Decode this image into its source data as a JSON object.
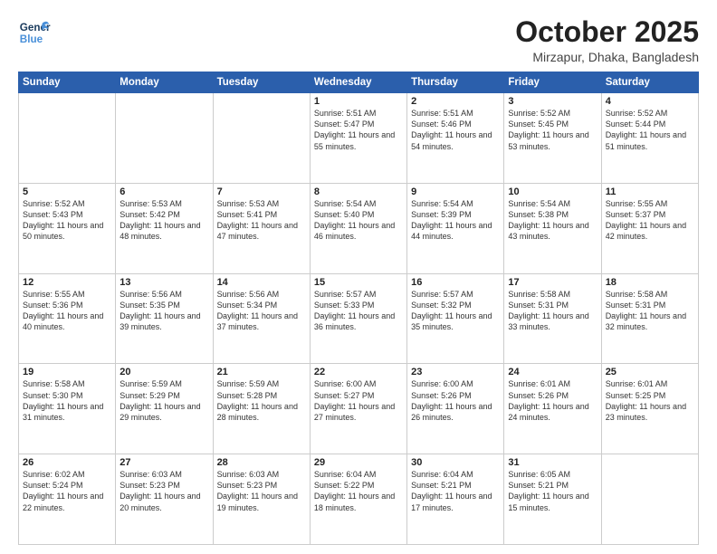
{
  "header": {
    "logo_general": "General",
    "logo_blue": "Blue",
    "title": "October 2025",
    "subtitle": "Mirzapur, Dhaka, Bangladesh"
  },
  "days_of_week": [
    "Sunday",
    "Monday",
    "Tuesday",
    "Wednesday",
    "Thursday",
    "Friday",
    "Saturday"
  ],
  "weeks": [
    [
      {
        "day": "",
        "info": ""
      },
      {
        "day": "",
        "info": ""
      },
      {
        "day": "",
        "info": ""
      },
      {
        "day": "1",
        "info": "Sunrise: 5:51 AM\nSunset: 5:47 PM\nDaylight: 11 hours\nand 55 minutes."
      },
      {
        "day": "2",
        "info": "Sunrise: 5:51 AM\nSunset: 5:46 PM\nDaylight: 11 hours\nand 54 minutes."
      },
      {
        "day": "3",
        "info": "Sunrise: 5:52 AM\nSunset: 5:45 PM\nDaylight: 11 hours\nand 53 minutes."
      },
      {
        "day": "4",
        "info": "Sunrise: 5:52 AM\nSunset: 5:44 PM\nDaylight: 11 hours\nand 51 minutes."
      }
    ],
    [
      {
        "day": "5",
        "info": "Sunrise: 5:52 AM\nSunset: 5:43 PM\nDaylight: 11 hours\nand 50 minutes."
      },
      {
        "day": "6",
        "info": "Sunrise: 5:53 AM\nSunset: 5:42 PM\nDaylight: 11 hours\nand 48 minutes."
      },
      {
        "day": "7",
        "info": "Sunrise: 5:53 AM\nSunset: 5:41 PM\nDaylight: 11 hours\nand 47 minutes."
      },
      {
        "day": "8",
        "info": "Sunrise: 5:54 AM\nSunset: 5:40 PM\nDaylight: 11 hours\nand 46 minutes."
      },
      {
        "day": "9",
        "info": "Sunrise: 5:54 AM\nSunset: 5:39 PM\nDaylight: 11 hours\nand 44 minutes."
      },
      {
        "day": "10",
        "info": "Sunrise: 5:54 AM\nSunset: 5:38 PM\nDaylight: 11 hours\nand 43 minutes."
      },
      {
        "day": "11",
        "info": "Sunrise: 5:55 AM\nSunset: 5:37 PM\nDaylight: 11 hours\nand 42 minutes."
      }
    ],
    [
      {
        "day": "12",
        "info": "Sunrise: 5:55 AM\nSunset: 5:36 PM\nDaylight: 11 hours\nand 40 minutes."
      },
      {
        "day": "13",
        "info": "Sunrise: 5:56 AM\nSunset: 5:35 PM\nDaylight: 11 hours\nand 39 minutes."
      },
      {
        "day": "14",
        "info": "Sunrise: 5:56 AM\nSunset: 5:34 PM\nDaylight: 11 hours\nand 37 minutes."
      },
      {
        "day": "15",
        "info": "Sunrise: 5:57 AM\nSunset: 5:33 PM\nDaylight: 11 hours\nand 36 minutes."
      },
      {
        "day": "16",
        "info": "Sunrise: 5:57 AM\nSunset: 5:32 PM\nDaylight: 11 hours\nand 35 minutes."
      },
      {
        "day": "17",
        "info": "Sunrise: 5:58 AM\nSunset: 5:31 PM\nDaylight: 11 hours\nand 33 minutes."
      },
      {
        "day": "18",
        "info": "Sunrise: 5:58 AM\nSunset: 5:31 PM\nDaylight: 11 hours\nand 32 minutes."
      }
    ],
    [
      {
        "day": "19",
        "info": "Sunrise: 5:58 AM\nSunset: 5:30 PM\nDaylight: 11 hours\nand 31 minutes."
      },
      {
        "day": "20",
        "info": "Sunrise: 5:59 AM\nSunset: 5:29 PM\nDaylight: 11 hours\nand 29 minutes."
      },
      {
        "day": "21",
        "info": "Sunrise: 5:59 AM\nSunset: 5:28 PM\nDaylight: 11 hours\nand 28 minutes."
      },
      {
        "day": "22",
        "info": "Sunrise: 6:00 AM\nSunset: 5:27 PM\nDaylight: 11 hours\nand 27 minutes."
      },
      {
        "day": "23",
        "info": "Sunrise: 6:00 AM\nSunset: 5:26 PM\nDaylight: 11 hours\nand 26 minutes."
      },
      {
        "day": "24",
        "info": "Sunrise: 6:01 AM\nSunset: 5:26 PM\nDaylight: 11 hours\nand 24 minutes."
      },
      {
        "day": "25",
        "info": "Sunrise: 6:01 AM\nSunset: 5:25 PM\nDaylight: 11 hours\nand 23 minutes."
      }
    ],
    [
      {
        "day": "26",
        "info": "Sunrise: 6:02 AM\nSunset: 5:24 PM\nDaylight: 11 hours\nand 22 minutes."
      },
      {
        "day": "27",
        "info": "Sunrise: 6:03 AM\nSunset: 5:23 PM\nDaylight: 11 hours\nand 20 minutes."
      },
      {
        "day": "28",
        "info": "Sunrise: 6:03 AM\nSunset: 5:23 PM\nDaylight: 11 hours\nand 19 minutes."
      },
      {
        "day": "29",
        "info": "Sunrise: 6:04 AM\nSunset: 5:22 PM\nDaylight: 11 hours\nand 18 minutes."
      },
      {
        "day": "30",
        "info": "Sunrise: 6:04 AM\nSunset: 5:21 PM\nDaylight: 11 hours\nand 17 minutes."
      },
      {
        "day": "31",
        "info": "Sunrise: 6:05 AM\nSunset: 5:21 PM\nDaylight: 11 hours\nand 15 minutes."
      },
      {
        "day": "",
        "info": ""
      }
    ]
  ]
}
